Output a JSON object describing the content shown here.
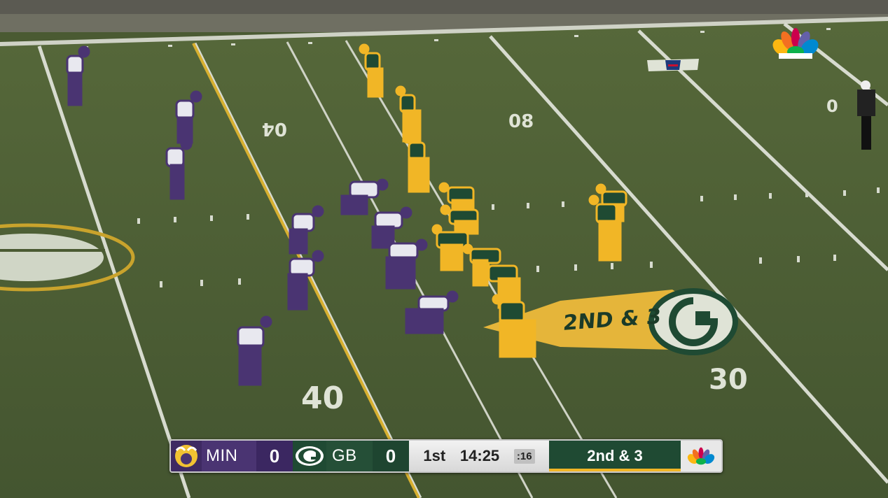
{
  "field_numbers": {
    "left_40": "40",
    "left_30": "30",
    "far_40": "04",
    "far_30": "08",
    "far_20": "0"
  },
  "field_overlay": {
    "down_distance": "2ND & 3"
  },
  "scorebug": {
    "away": {
      "abbr": "MIN",
      "score": "0",
      "color": "#4a3472"
    },
    "home": {
      "abbr": "GB",
      "score": "0",
      "color": "#254f37"
    },
    "quarter": "1st",
    "clock": "14:25",
    "play_clock": ":16",
    "down_distance": "2nd & 3",
    "network_icon": "nbc-peacock-icon"
  },
  "colors": {
    "field": "#4a5a32",
    "yellow_line": "#d8b030",
    "vikings_purple": "#4a3472",
    "packers_green": "#1f4a33",
    "packers_gold": "#f1b626"
  }
}
